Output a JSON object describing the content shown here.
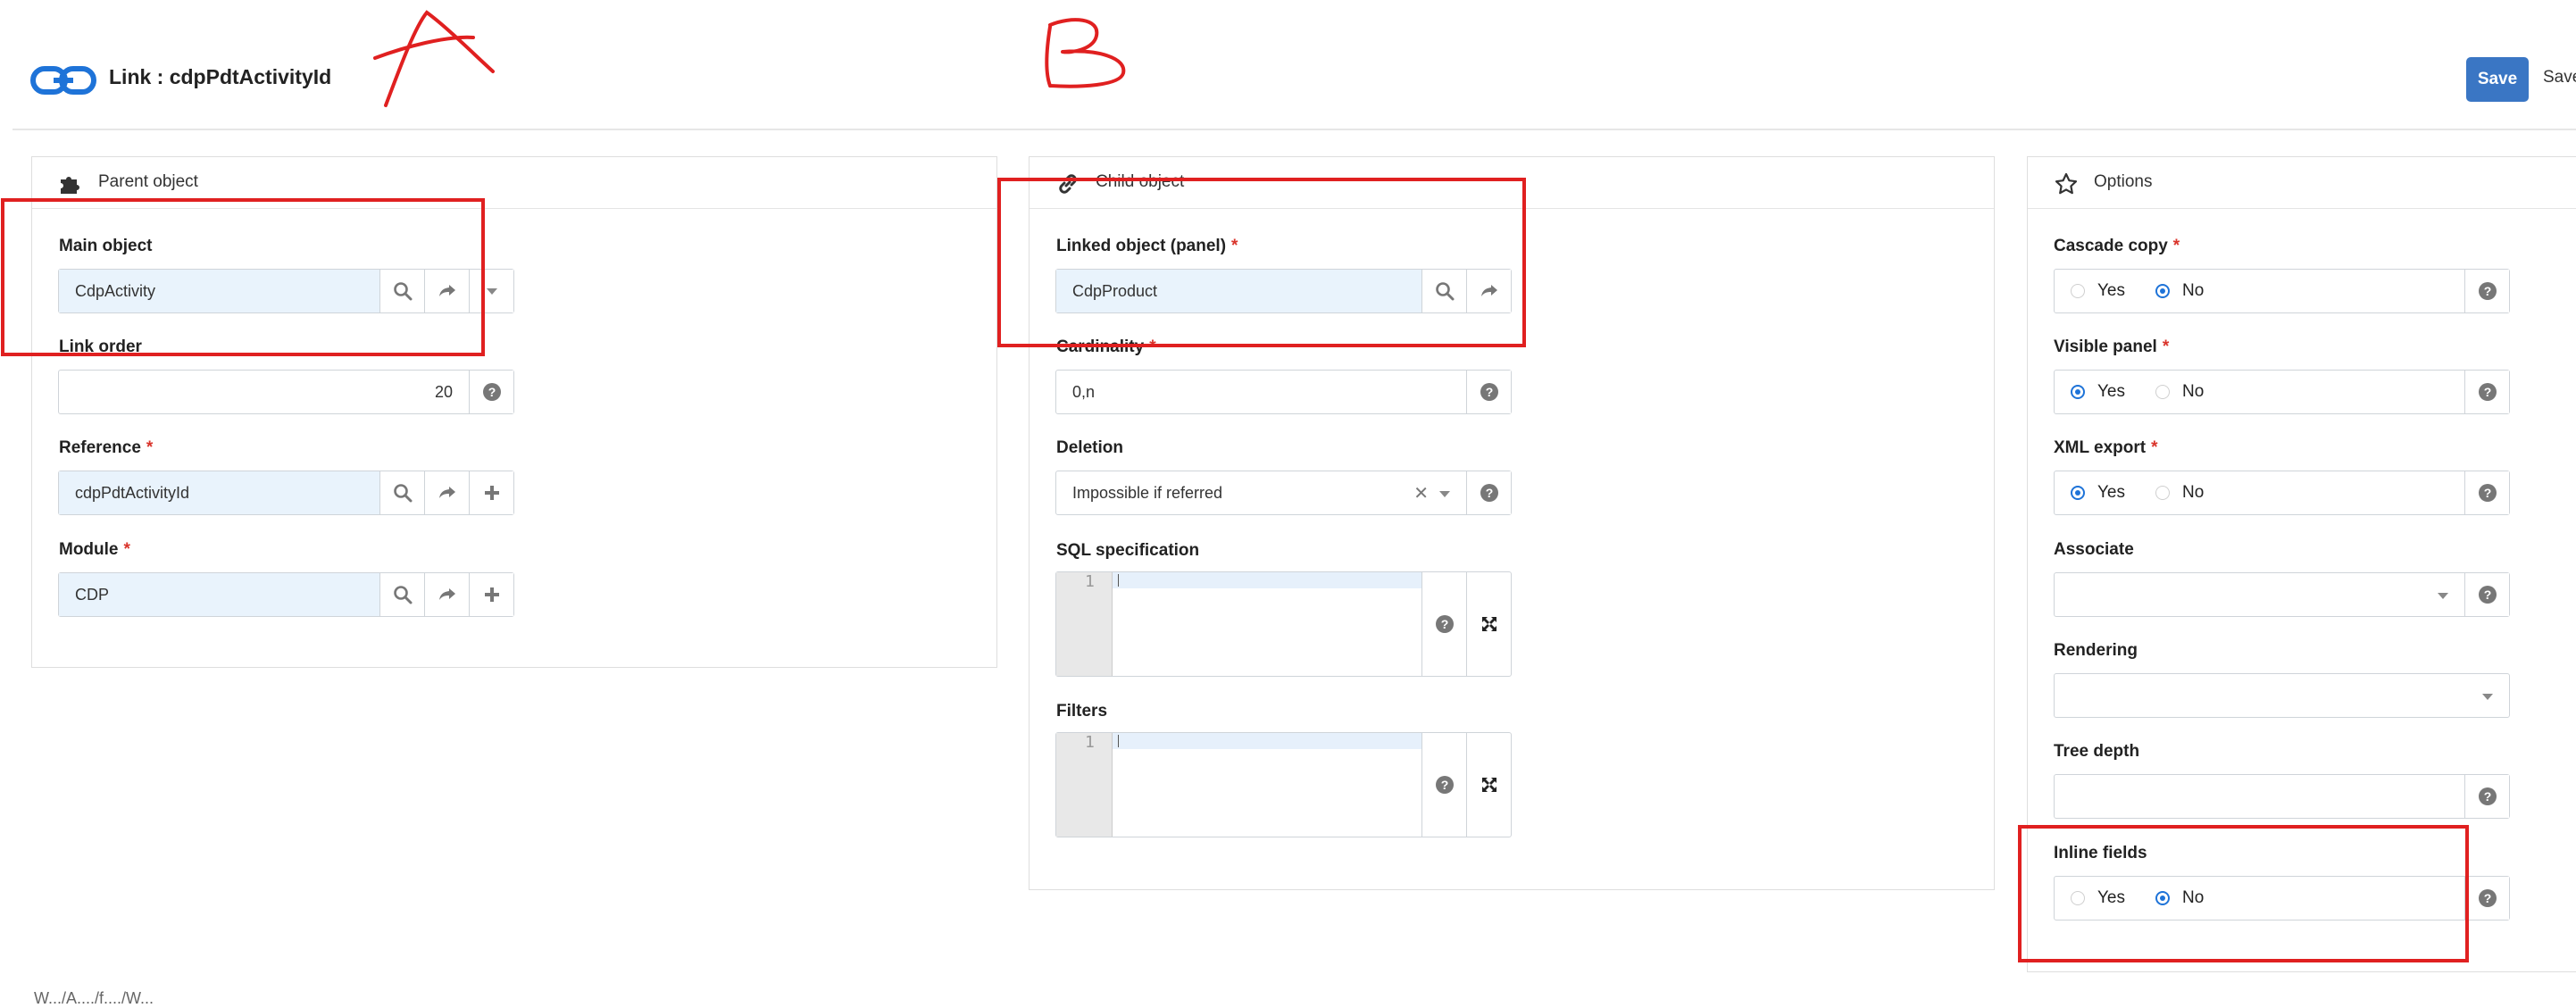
{
  "header": {
    "title": "Link : cdpPdtActivityId",
    "save_label": "Save",
    "save_close_label": "Save"
  },
  "parent_panel": {
    "title": "Parent object",
    "main_object": {
      "label": "Main object",
      "value": "CdpActivity"
    },
    "link_order": {
      "label": "Link order",
      "value": "20"
    },
    "reference": {
      "label": "Reference",
      "required": "*",
      "value": "cdpPdtActivityId"
    },
    "module": {
      "label": "Module",
      "required": "*",
      "value": "CDP"
    }
  },
  "child_panel": {
    "title": "Child object",
    "linked_object": {
      "label": "Linked object (panel)",
      "required": "*",
      "value": "CdpProduct"
    },
    "cardinality": {
      "label": "Cardinality",
      "required": "*",
      "value": "0,n"
    },
    "deletion": {
      "label": "Deletion",
      "value": "Impossible if referred"
    },
    "sql_spec": {
      "label": "SQL specification",
      "line_number": "1"
    },
    "filters": {
      "label": "Filters",
      "line_number": "1"
    }
  },
  "options_panel": {
    "title": "Options",
    "cascade_copy": {
      "label": "Cascade copy",
      "required": "*",
      "yes": "Yes",
      "no": "No",
      "selected": "No"
    },
    "visible_panel": {
      "label": "Visible panel",
      "required": "*",
      "yes": "Yes",
      "no": "No",
      "selected": "Yes"
    },
    "xml_export": {
      "label": "XML export",
      "required": "*",
      "yes": "Yes",
      "no": "No",
      "selected": "Yes"
    },
    "associate": {
      "label": "Associate",
      "value": ""
    },
    "rendering": {
      "label": "Rendering",
      "value": ""
    },
    "tree_depth": {
      "label": "Tree depth",
      "value": ""
    },
    "inline_fields": {
      "label": "Inline fields",
      "yes": "Yes",
      "no": "No",
      "selected": "No"
    }
  },
  "annotations": {
    "letter_a": "A",
    "letter_b": "B"
  },
  "footer": {
    "text": "W.../A..../f..../W..."
  },
  "colors": {
    "primary": "#3a76c4",
    "annotation": "#e02020",
    "reference_bg": "#e9f3fc",
    "required": "#d9342b",
    "radio": "#1e73d8"
  },
  "icons": [
    "link-icon",
    "puzzle-icon",
    "chain-icon",
    "star-icon",
    "search-icon",
    "share-arrow-icon",
    "plus-icon",
    "help-icon",
    "expand-icon",
    "caret-down-icon",
    "clear-icon"
  ]
}
